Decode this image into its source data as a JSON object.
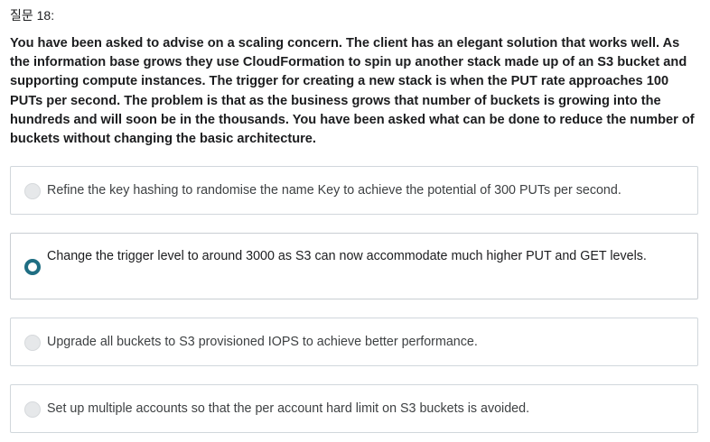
{
  "question": {
    "number_label": "질문 18:",
    "text": "You have been asked to advise on a scaling concern. The client has an elegant solution that works well. As the information base grows they use CloudFormation to spin up another stack made up of an S3 bucket and supporting compute instances. The trigger for creating a new stack is when the PUT rate approaches 100 PUTs per second. The problem is that as the business grows that number of buckets is growing into the hundreds and will soon be in the thousands. You have been asked what can be done to reduce the number of buckets without changing the basic architecture."
  },
  "options": [
    {
      "label": "Refine the key hashing to randomise the name Key to achieve the potential of 300 PUTs per second.",
      "selected": false
    },
    {
      "label": "Change the trigger level to around 3000 as S3 can now accommodate much higher PUT and GET levels.",
      "selected": true
    },
    {
      "label": "Upgrade all buckets to S3 provisioned IOPS to achieve better performance.",
      "selected": false
    },
    {
      "label": "Set up multiple accounts so that the per account hard limit on S3 buckets is avoided.",
      "selected": false
    }
  ],
  "colors": {
    "selected_radio": "#1f6e83",
    "unselected_radio": "#e6e8ea",
    "border": "#d1d7dc",
    "text": "#1c1d1f"
  }
}
